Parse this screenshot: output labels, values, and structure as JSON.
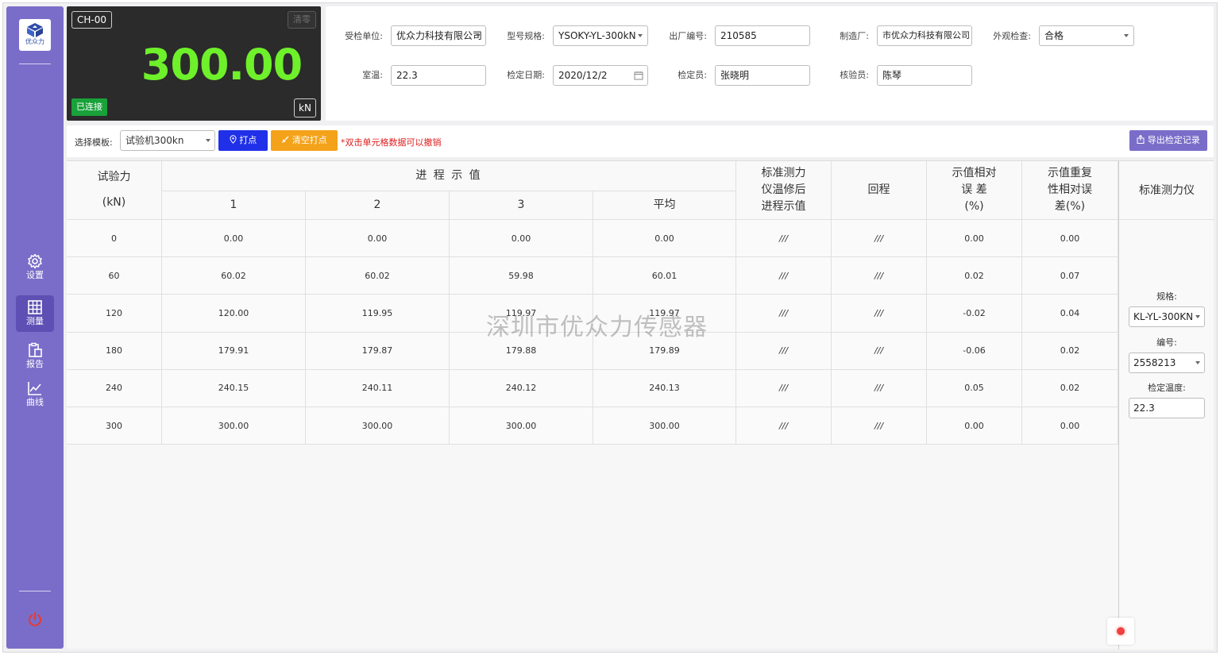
{
  "sidebar": {
    "logo_text": "优众力",
    "nav": [
      {
        "label": "设置",
        "icon": "gear-icon"
      },
      {
        "label": "测量",
        "icon": "grid-icon",
        "active": true
      },
      {
        "label": "报告",
        "icon": "clipboard-icon"
      },
      {
        "label": "曲线",
        "icon": "chart-line-icon"
      }
    ],
    "power_icon": "power-icon"
  },
  "display": {
    "channel": "CH-00",
    "zero_label": "清零",
    "value": "300.00",
    "status": "已连接",
    "unit": "kN",
    "value_color": "#6ef02a"
  },
  "form": {
    "client_label": "受检单位:",
    "client_value": "优众力科技有限公司",
    "model_label": "型号规格:",
    "model_value": "YSOKY-YL-300kN",
    "serial_label": "出厂编号:",
    "serial_value": "210585",
    "maker_label": "制造厂:",
    "maker_value": "市优众力科技有限公司",
    "appearance_label": "外观检查:",
    "appearance_value": "合格",
    "temp_label": "室温:",
    "temp_value": "22.3",
    "date_label": "检定日期:",
    "date_value": "2020/12/2",
    "inspector_label": "检定员:",
    "inspector_value": "张晓明",
    "verifier_label": "核验员:",
    "verifier_value": "陈琴"
  },
  "toolbar": {
    "template_label": "选择模板:",
    "template_value": "试验机300kn",
    "point_label": "打点",
    "clear_label": "清空打点",
    "hint": "*双击单元格数据可以撤销",
    "export_label": "导出检定记录"
  },
  "table": {
    "col_force_1": "试验力",
    "col_force_2": "(kN)",
    "col_progress": "进 程 示 值",
    "sub_cols": [
      "1",
      "2",
      "3",
      "平均"
    ],
    "col_std_1": "标准测力",
    "col_std_2": "仪温修后",
    "col_std_3": "进程示值",
    "col_return": "回程",
    "col_err_1": "示值相对",
    "col_err_2": "误  差",
    "col_err_3": "(%)",
    "col_rep_1": "示值重复",
    "col_rep_2": "性相对误",
    "col_rep_3": "差(%)",
    "rows": [
      {
        "force": "0",
        "v1": "0.00",
        "v2": "0.00",
        "v3": "0.00",
        "avg": "0.00",
        "std": "///",
        "ret": "///",
        "err": "0.00",
        "rep": "0.00"
      },
      {
        "force": "60",
        "v1": "60.02",
        "v2": "60.02",
        "v3": "59.98",
        "avg": "60.01",
        "std": "///",
        "ret": "///",
        "err": "0.02",
        "rep": "0.07"
      },
      {
        "force": "120",
        "v1": "120.00",
        "v2": "119.95",
        "v3": "119.97",
        "avg": "119.97",
        "std": "///",
        "ret": "///",
        "err": "-0.02",
        "rep": "0.04"
      },
      {
        "force": "180",
        "v1": "179.91",
        "v2": "179.87",
        "v3": "179.88",
        "avg": "179.89",
        "std": "///",
        "ret": "///",
        "err": "-0.06",
        "rep": "0.02"
      },
      {
        "force": "240",
        "v1": "240.15",
        "v2": "240.11",
        "v3": "240.12",
        "avg": "240.13",
        "std": "///",
        "ret": "///",
        "err": "0.05",
        "rep": "0.02"
      },
      {
        "force": "300",
        "v1": "300.00",
        "v2": "300.00",
        "v3": "300.00",
        "avg": "300.00",
        "std": "///",
        "ret": "///",
        "err": "0.00",
        "rep": "0.00"
      }
    ]
  },
  "std_instrument": {
    "title": "标准测力仪",
    "spec_label": "规格:",
    "spec_value": "KL-YL-300KN",
    "number_label": "编号:",
    "number_value": "2558213",
    "temp_label": "检定温度:",
    "temp_value": "22.3"
  },
  "watermark": "深圳市优众力传感器"
}
